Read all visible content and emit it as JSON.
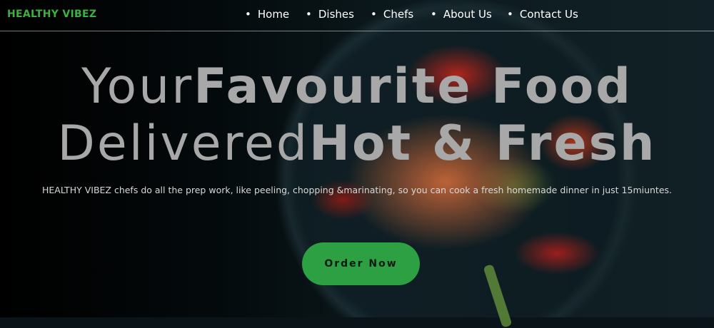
{
  "brand": {
    "name": "HEALTHY VIBEZ"
  },
  "nav": {
    "items": [
      {
        "label": "Home"
      },
      {
        "label": "Dishes"
      },
      {
        "label": "Chefs"
      },
      {
        "label": "About Us"
      },
      {
        "label": "Contact Us"
      }
    ]
  },
  "hero": {
    "title_line1_a": "Your",
    "title_line1_b": "Favourite Food",
    "title_line2_a": "Delivered",
    "title_line2_b": "Hot & Fresh",
    "description": "HEALTHY VIBEZ chefs do all the prep work, like peeling, chopping &marinating, so you can cook a fresh homemade dinner in just 15miuntes.",
    "cta_label": "Order Now"
  },
  "colors": {
    "brand": "#3cb043",
    "cta_background": "#2ea044",
    "title_text": "#a8a8a8",
    "nav_text": "#ffffff"
  }
}
